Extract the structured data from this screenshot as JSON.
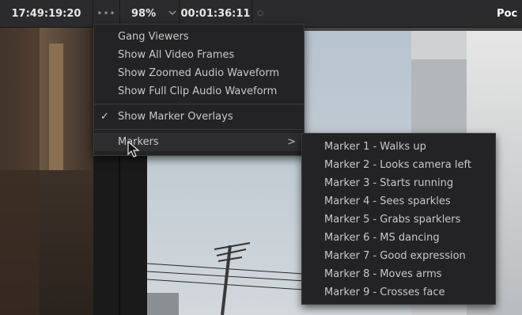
{
  "toolbar": {
    "timecode": "17:49:19:20",
    "options_dots": "•••",
    "zoom": "98%",
    "zoom_chevron": "chevron-down-icon",
    "duration": "00:01:36:11",
    "indicator": "○",
    "title": "Poc"
  },
  "viewer_menu": {
    "items": [
      {
        "label": "Gang Viewers"
      },
      {
        "label": "Show All Video Frames"
      },
      {
        "label": "Show Zoomed Audio Waveform"
      },
      {
        "label": "Show Full Clip Audio Waveform"
      },
      {
        "label": "Show Marker Overlays",
        "checked": true,
        "check_mark": "✓"
      },
      {
        "label": "Markers",
        "submenu_arrow": ">"
      }
    ]
  },
  "markers_submenu": {
    "items": [
      "Marker 1 - Walks up",
      "Marker 2 - Looks camera left",
      "Marker 3 - Starts running",
      "Marker 4 - Sees sparkles",
      "Marker 5 - Grabs sparklers",
      "Marker 6 - MS dancing",
      "Marker 7 - Good expression",
      "Marker 8 - Moves arms",
      "Marker 9 - Crosses face"
    ]
  },
  "colors": {
    "toolbar_bg": "#2b2b2d",
    "menu_bg": "#232325",
    "menu_text": "#c8c8c8",
    "sky": "#c3ccd4"
  }
}
